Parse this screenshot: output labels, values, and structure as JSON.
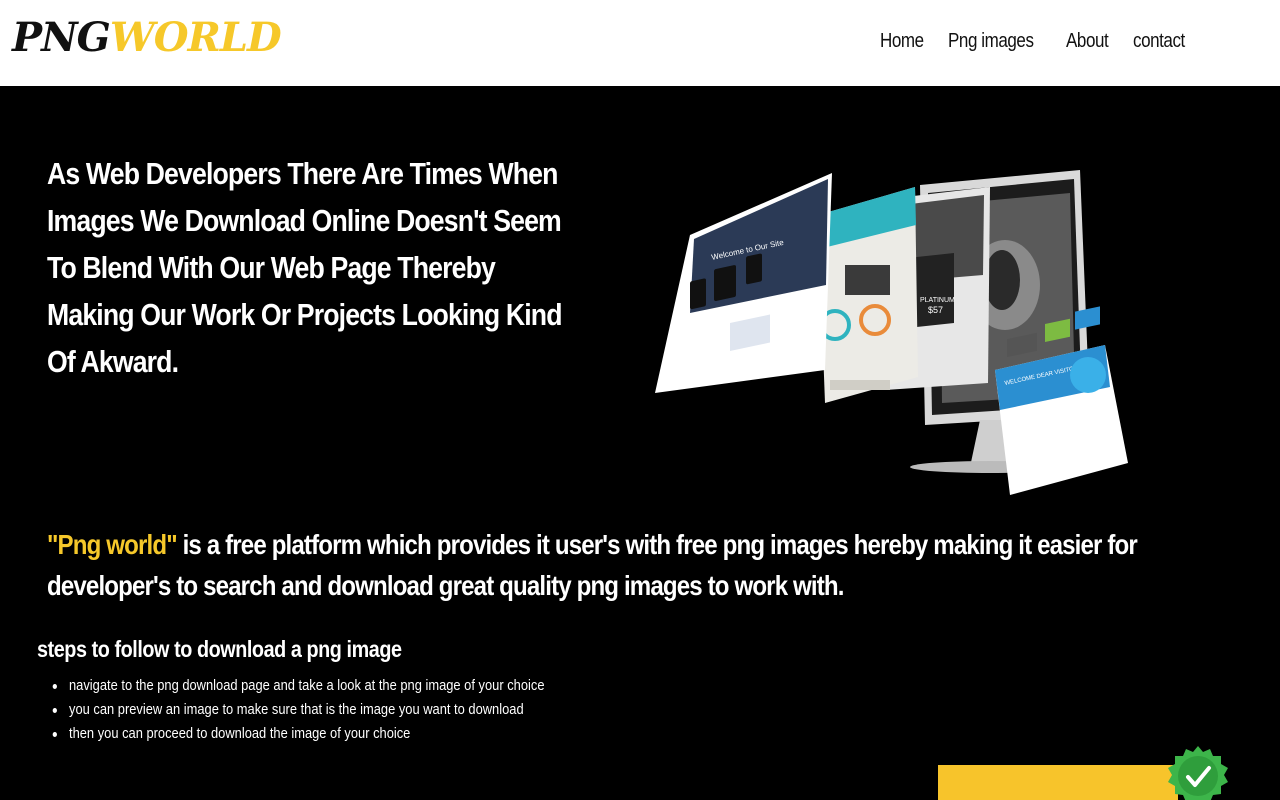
{
  "header": {
    "logo_part1": "PNG",
    "logo_part2": "WORLD",
    "nav": [
      "Home",
      "Png images",
      "About",
      "contact"
    ]
  },
  "hero": {
    "text": "As Web Developers There Are Times When Images We Download Online Doesn't Seem To Blend With Our Web Page Thereby Making Our Work Or Projects Looking Kind Of Akward.",
    "mockup_headline_1": "Welcome to Our Site",
    "mockup_headline_2": "WELCOME DEAR VISITORS",
    "mockup_price": "$57",
    "mockup_plan": "PLATINUM"
  },
  "intro": {
    "brand": "\"Png world\"",
    "text": " is a free platform which provides it user's with free png images hereby making it easier for developer's to search and download great quality png images to work with."
  },
  "steps": {
    "title": "steps to follow to download a png image",
    "items": [
      "navigate to the png download page and take a look at the png image of your choice",
      "you can preview an image to make sure that is the image you want to download",
      "then you can proceed to download the image of your choice"
    ]
  },
  "colors": {
    "accent": "#f6c82a",
    "background": "#000000",
    "header": "#ffffff",
    "badge": "#3db54a"
  }
}
